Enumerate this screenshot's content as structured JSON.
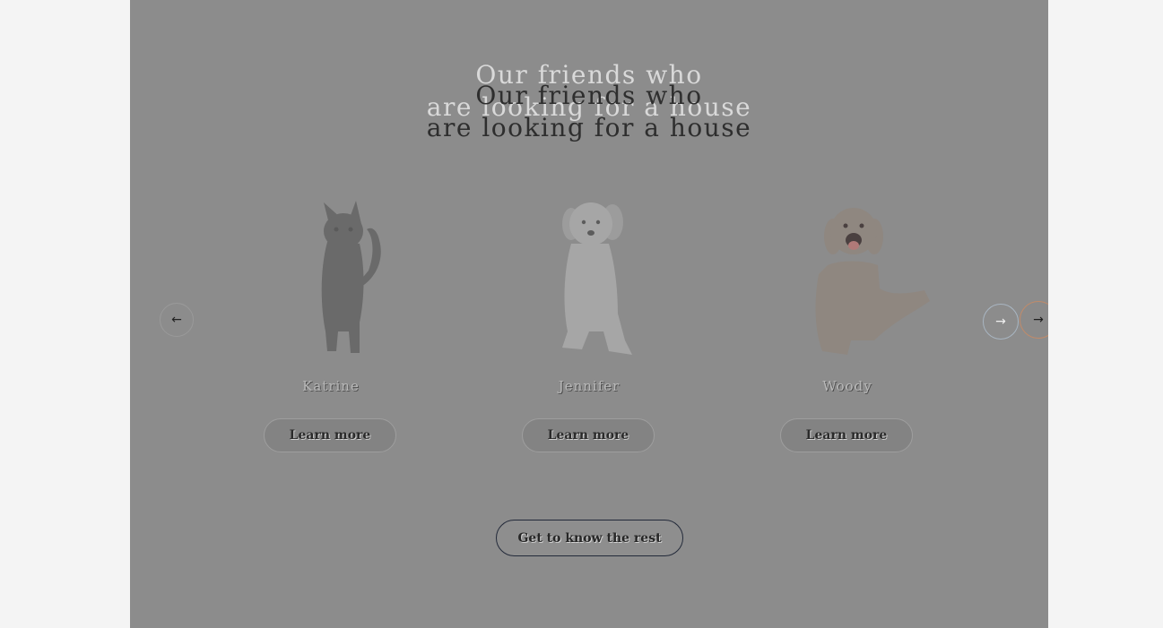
{
  "pets": {
    "heading": "Our friends who are looking for a house",
    "heading_line1": "Our friends who",
    "heading_line2": "are looking for a house",
    "prev_icon": "←",
    "next_icon": "→",
    "cards": [
      {
        "name": "Katrine",
        "button": "Learn more",
        "image": "cat-photo"
      },
      {
        "name": "Jennifer",
        "button": "Learn more",
        "image": "puppy-photo"
      },
      {
        "name": "Woody",
        "button": "Learn more",
        "image": "dog-photo"
      }
    ],
    "rest_button": "Get to know the rest"
  }
}
